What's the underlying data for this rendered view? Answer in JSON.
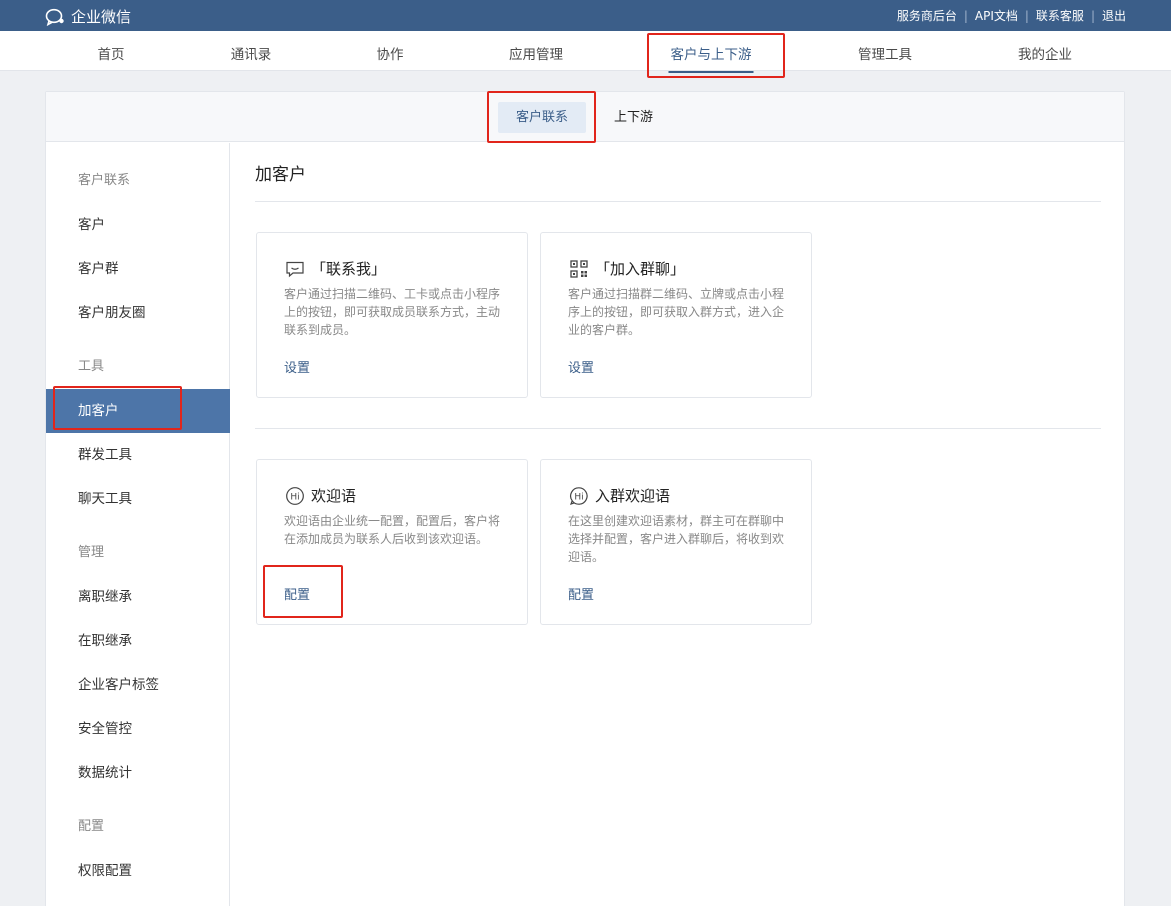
{
  "app": {
    "logo_text": "企业微信"
  },
  "top_links": [
    {
      "label": "服务商后台"
    },
    {
      "label": "API文档"
    },
    {
      "label": "联系客服"
    },
    {
      "label": "退出"
    }
  ],
  "main_nav": [
    {
      "label": "首页"
    },
    {
      "label": "通讯录"
    },
    {
      "label": "协作"
    },
    {
      "label": "应用管理"
    },
    {
      "label": "客户与上下游",
      "active": true
    },
    {
      "label": "管理工具"
    },
    {
      "label": "我的企业"
    }
  ],
  "sub_tabs": [
    {
      "label": "客户联系",
      "active": true
    },
    {
      "label": "上下游"
    }
  ],
  "sidebar": {
    "groups": [
      {
        "title": "客户联系",
        "items": [
          {
            "label": "客户"
          },
          {
            "label": "客户群"
          },
          {
            "label": "客户朋友圈"
          }
        ]
      },
      {
        "title": "工具",
        "items": [
          {
            "label": "加客户",
            "active": true
          },
          {
            "label": "群发工具"
          },
          {
            "label": "聊天工具"
          }
        ]
      },
      {
        "title": "管理",
        "items": [
          {
            "label": "离职继承"
          },
          {
            "label": "在职继承"
          },
          {
            "label": "企业客户标签"
          },
          {
            "label": "安全管控"
          },
          {
            "label": "数据统计"
          }
        ]
      },
      {
        "title": "配置",
        "items": [
          {
            "label": "权限配置"
          }
        ]
      }
    ]
  },
  "content": {
    "title": "加客户",
    "cards": [
      {
        "icon": "message-icon",
        "title": "「联系我」",
        "desc": "客户通过扫描二维码、工卡或点击小程序上的按钮，即可获取成员联系方式，主动联系到成员。",
        "action": "设置"
      },
      {
        "icon": "qr-code-icon",
        "title": "「加入群聊」",
        "desc": "客户通过扫描群二维码、立牌或点击小程序上的按钮，即可获取入群方式，进入企业的客户群。",
        "action": "设置"
      },
      {
        "icon": "hi-greeting-icon",
        "title": "欢迎语",
        "desc": "欢迎语由企业统一配置，配置后，客户将在添加成员为联系人后收到该欢迎语。",
        "action": "配置"
      },
      {
        "icon": "hi-group-greeting-icon",
        "title": "入群欢迎语",
        "desc": "在这里创建欢迎语素材，群主可在群聊中选择并配置，客户进入群聊后，将收到欢迎语。",
        "action": "配置"
      }
    ]
  },
  "colors": {
    "topbar": "#3b5e89",
    "accent": "#3b5e89",
    "sidebar_active": "#4d75a8",
    "highlight_box": "#e1251b"
  }
}
